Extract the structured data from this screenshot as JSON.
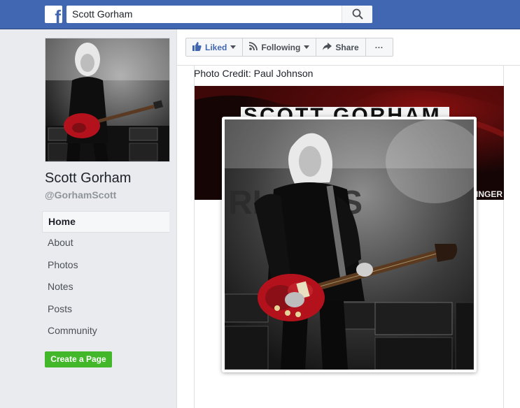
{
  "topbar": {
    "logo_icon": "facebook-f-icon",
    "search_value": "Scott Gorham",
    "search_icon": "search-icon"
  },
  "profile": {
    "name": "Scott Gorham",
    "handle": "@GorhamScott"
  },
  "nav": {
    "items": [
      {
        "label": "Home",
        "active": true
      },
      {
        "label": "About"
      },
      {
        "label": "Photos"
      },
      {
        "label": "Notes"
      },
      {
        "label": "Posts"
      },
      {
        "label": "Community"
      }
    ]
  },
  "create_page_label": "Create a Page",
  "actions": {
    "liked": "Liked",
    "following": "Following",
    "share": "Share",
    "more": "···"
  },
  "post": {
    "caption": "Photo Credit: Paul Johnson",
    "banner_title": "SCOTT GORHAM",
    "banner_subtitle": "SLINGER"
  },
  "colors": {
    "brand_blue": "#4267b2",
    "create_green": "#42b72a",
    "guitar_red": "#b3121d"
  }
}
